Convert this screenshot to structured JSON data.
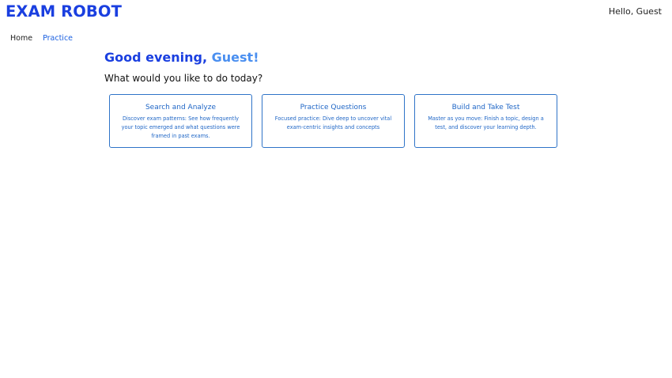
{
  "header": {
    "logo": "EXAM ROBOT",
    "user_greeting": "Hello, Guest"
  },
  "nav": {
    "items": [
      {
        "label": "Home"
      },
      {
        "label": "Practice"
      }
    ]
  },
  "main": {
    "title_part1": "Good evening,",
    "title_part2": "Guest!",
    "subtitle": "What would you like to do today?",
    "cards": [
      {
        "title": "Search and Analyze",
        "description": "Discover exam patterns: See how frequently your topic emerged and what questions were framed in past exams."
      },
      {
        "title": "Practice Questions",
        "description": "Focused practice: Dive deep to uncover vital exam-centric insights and concepts"
      },
      {
        "title": "Build and Take Test",
        "description": "Master as you move: Finish a topic, design a test, and discover your learning depth."
      }
    ]
  },
  "colors": {
    "brand": "#1a3fe0",
    "accent": "#4a8ff0",
    "card_border": "#2f74c8",
    "card_text": "#1f66c6"
  }
}
